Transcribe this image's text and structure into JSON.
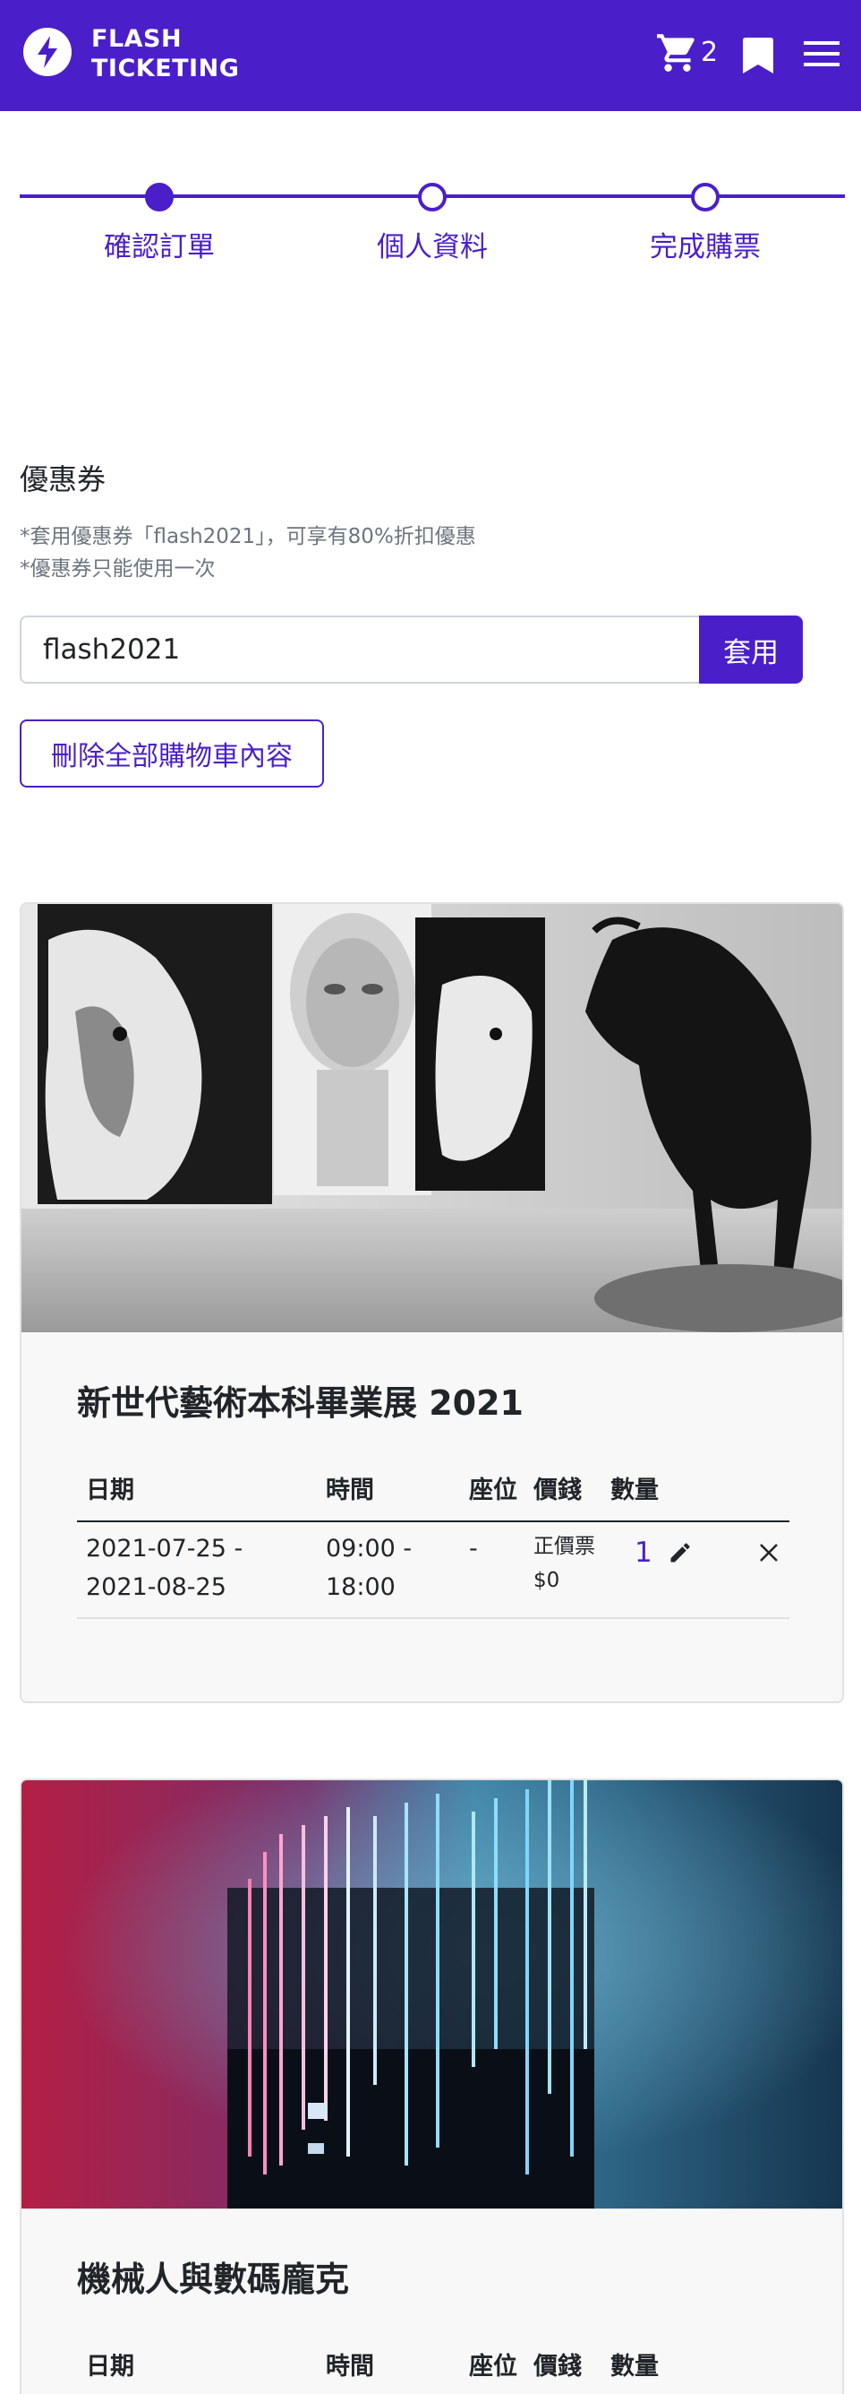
{
  "header": {
    "brand_line1": "FLASH",
    "brand_line2": "TICKETING",
    "cart_count": "2",
    "logo_icon": "lightning-icon",
    "cart_icon": "cart-icon",
    "bookmark_icon": "bookmark-icon",
    "menu_icon": "hamburger-menu-icon",
    "color": "#4a1fc9"
  },
  "stepper": {
    "steps": [
      {
        "label": "確認訂單",
        "active": true
      },
      {
        "label": "個人資料",
        "active": false
      },
      {
        "label": "完成購票",
        "active": false
      }
    ]
  },
  "coupon": {
    "title": "優惠券",
    "note1": "*套用優惠券「flash2021」，可享有80%折扣優惠",
    "note2": "*優惠券只能使用一次",
    "input_value": "flash2021",
    "apply_label": "套用",
    "delete_all_label": "刪除全部購物車內容"
  },
  "table_headers": {
    "date": "日期",
    "time": "時間",
    "seat": "座位",
    "price": "價錢",
    "quantity": "數量"
  },
  "cart_items": [
    {
      "title": "新世代藝術本科畢業展 2021",
      "date_line1": "2021-07-25 -",
      "date_line2": "2021-08-25",
      "time_line1": "09:00 -",
      "time_line2": "18:00",
      "seat": "-",
      "ticket_type": "正價票",
      "price": "$0",
      "quantity": "1"
    },
    {
      "title": "機械人與數碼龐克"
    }
  ]
}
